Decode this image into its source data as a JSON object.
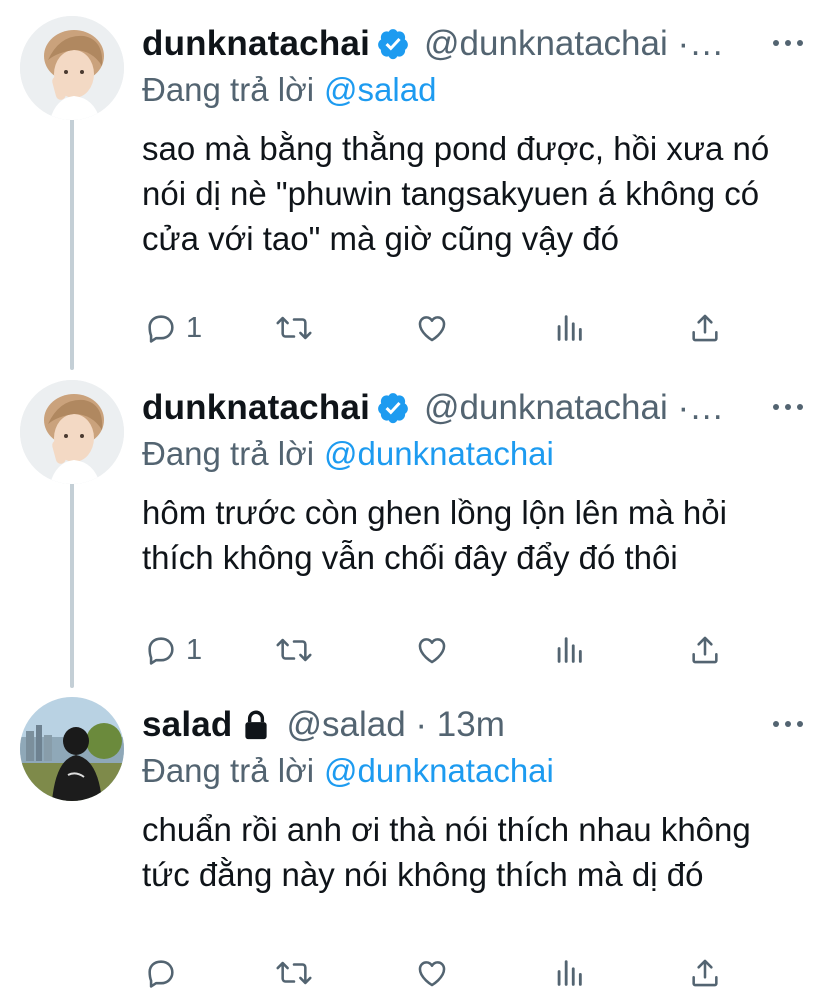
{
  "tweets": [
    {
      "display_name": "dunknatachai",
      "handle": "@dunknatachai ·…",
      "verified": true,
      "reply_prefix": "Đang trả lời",
      "reply_to": "@salad",
      "text": "sao mà bằng thằng pond được, hồi xưa nó nói dị nè \"phuwin tangsakyuen á không có cửa với tao\" mà giờ cũng vậy đó",
      "reply_count": "1",
      "retweet_count": "",
      "like_count": "",
      "avatar_icon": "avatar-dunknatachai"
    },
    {
      "display_name": "dunknatachai",
      "handle": "@dunknatachai ·…",
      "verified": true,
      "reply_prefix": "Đang trả lời",
      "reply_to": "@dunknatachai",
      "text": "hôm trước còn ghen lồng lộn lên mà hỏi thích không vẫn chối đây đẩy đó thôi",
      "reply_count": "1",
      "retweet_count": "",
      "like_count": "",
      "avatar_icon": "avatar-dunknatachai"
    },
    {
      "display_name": "salad",
      "handle": "@salad · 13m",
      "verified": false,
      "protected": true,
      "reply_prefix": "Đang trả lời",
      "reply_to": "@dunknatachai",
      "text": "chuẩn rồi anh ơi thà nói thích nhau không tức đằng này nói không thích mà dị đó",
      "reply_count": "",
      "retweet_count": "",
      "like_count": "",
      "avatar_icon": "avatar-salad"
    }
  ],
  "colors": {
    "text": "#0f1419",
    "secondary": "#536471",
    "accent": "#1d9bf0",
    "thread_line": "#c4cfd6"
  },
  "icons": [
    "reply-icon",
    "retweet-icon",
    "like-icon",
    "analytics-icon",
    "share-icon",
    "more-icon",
    "verified-badge-icon",
    "lock-icon"
  ]
}
